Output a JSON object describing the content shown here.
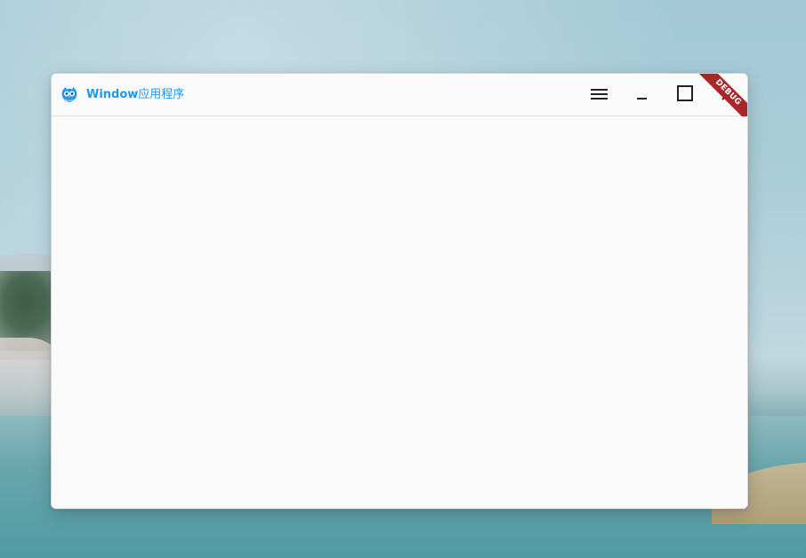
{
  "window": {
    "title": "Window应用程序",
    "title_latin": "Window",
    "title_cjk": "应用程序",
    "app_icon": "owl-logo-icon",
    "accent_color": "#2196f3",
    "controls": {
      "menu_icon": "hamburger-menu-icon",
      "minimize_icon": "minimize-icon",
      "maximize_icon": "maximize-icon",
      "close_icon": "close-icon"
    },
    "debug_banner": "DEBUG",
    "debug_color": "#a9272b"
  }
}
